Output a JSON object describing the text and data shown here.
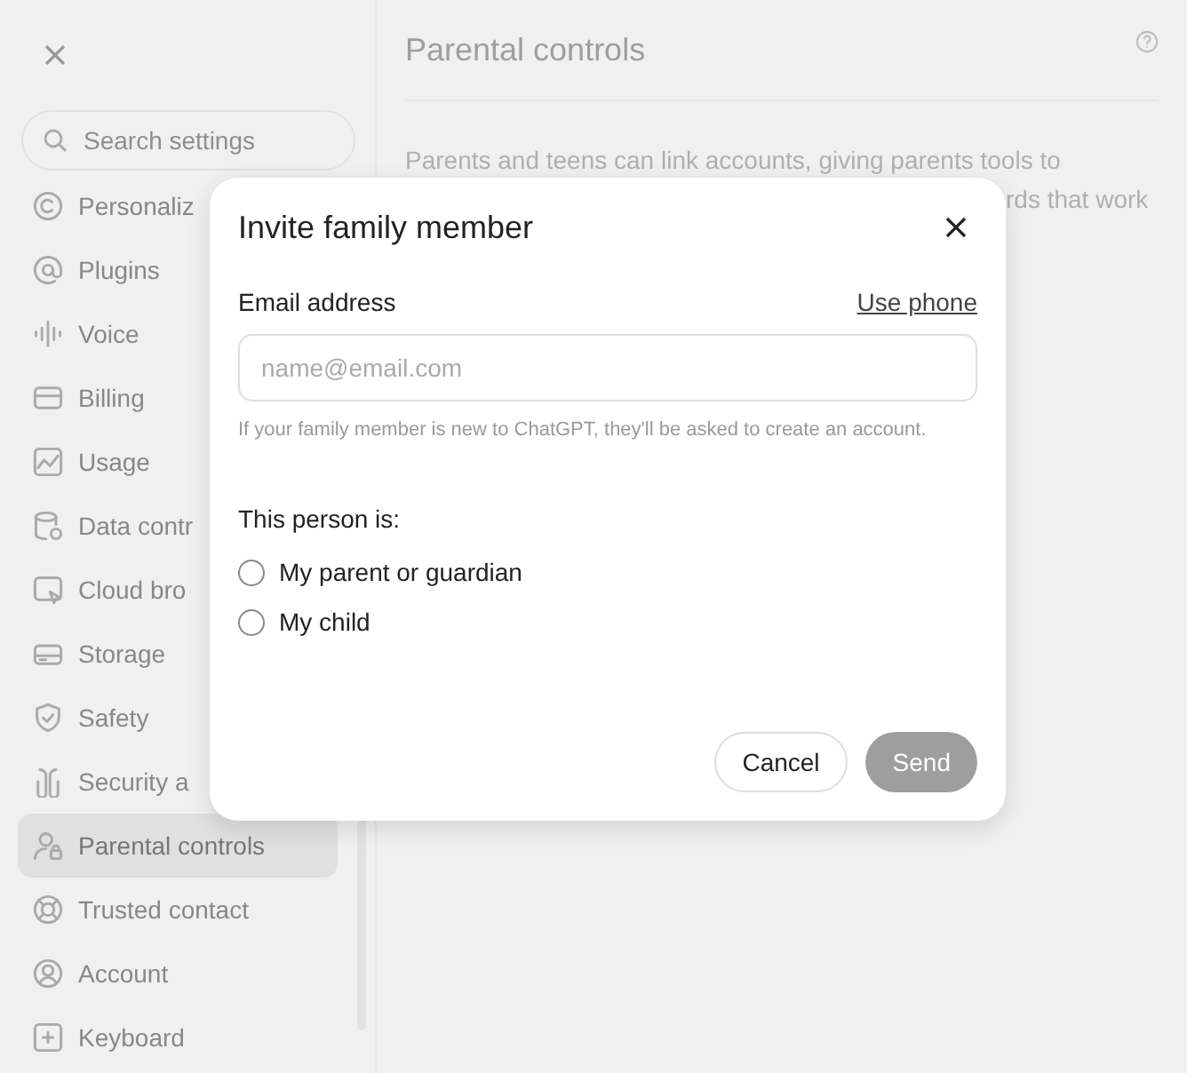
{
  "sidebar": {
    "search": {
      "placeholder": "Search settings"
    },
    "items": [
      {
        "label": "Personaliz",
        "selected": false
      },
      {
        "label": "Plugins",
        "selected": false
      },
      {
        "label": "Voice",
        "selected": false
      },
      {
        "label": "Billing",
        "selected": false
      },
      {
        "label": "Usage",
        "selected": false
      },
      {
        "label": "Data contr",
        "selected": false
      },
      {
        "label": "Cloud bro",
        "selected": false
      },
      {
        "label": "Storage",
        "selected": false
      },
      {
        "label": "Safety",
        "selected": false
      },
      {
        "label": "Security a",
        "selected": false
      },
      {
        "label": "Parental controls",
        "selected": true
      },
      {
        "label": "Trusted contact",
        "selected": false
      },
      {
        "label": "Account",
        "selected": false
      },
      {
        "label": "Keyboard",
        "selected": false
      }
    ]
  },
  "page": {
    "title": "Parental controls",
    "description_lines": [
      "Parents and teens can link accounts, giving parents tools to",
      "rds that work"
    ]
  },
  "dialog": {
    "title": "Invite family member",
    "email_label": "Email address",
    "use_phone": "Use phone",
    "email_field": {
      "placeholder": "name@email.com"
    },
    "hint": "If your family member is new to ChatGPT, they'll be asked to create an account.",
    "relation_label": "This person is:",
    "options": [
      {
        "label": "My parent or guardian",
        "selected": false
      },
      {
        "label": "My child",
        "selected": false
      }
    ],
    "buttons": [
      {
        "label": "Cancel",
        "kind": "secondary",
        "disabled": false
      },
      {
        "label": "Send",
        "kind": "primary",
        "disabled": true
      }
    ]
  }
}
